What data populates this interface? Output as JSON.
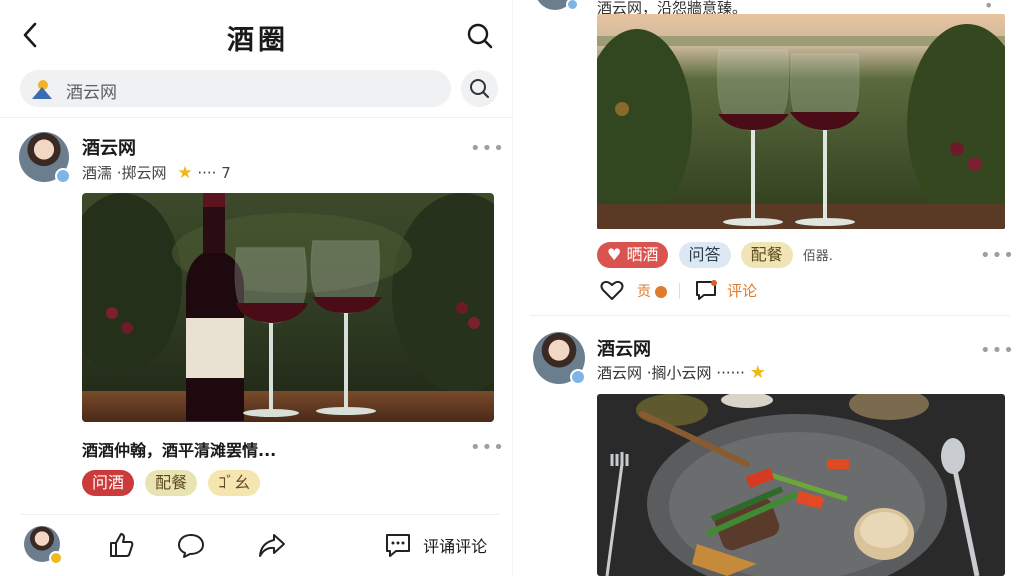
{
  "header": {
    "title": "酒圈"
  },
  "search": {
    "placeholder": "酒云网"
  },
  "left_post": {
    "author": "酒云网",
    "subline": "酒濡 ·掷云网",
    "subline_count": "···· 7",
    "caption": "酒酒仲翰，酒平清滩罢情...",
    "tags": [
      {
        "label": "问酒",
        "color": "#cc3b3b",
        "text_color": "#ffffff"
      },
      {
        "label": "配餐",
        "color": "#e9e3b4",
        "text_color": "#5b4a1a"
      },
      {
        "label": "ｺﾞ幺",
        "color": "#f5e6b0",
        "text_color": "#6a4a2a"
      }
    ]
  },
  "bottom_bar": {
    "comment_label": "评诵评论"
  },
  "right_post_top": {
    "author_line": "酒云网，沿怨牆意臻。",
    "tags": [
      {
        "label": "晒酒",
        "color": "#d9534f",
        "text_color": "#ffffff",
        "icon": "heart-icon"
      },
      {
        "label": "问答",
        "color": "#dde8f5",
        "text_color": "#2d3a4a"
      },
      {
        "label": "配餐",
        "color": "#f1e4b6",
        "text_color": "#5b4a1a"
      }
    ],
    "extra_tag": "佰器.",
    "like_label": "贡",
    "comment_label": "评论"
  },
  "right_post_bottom": {
    "author": "酒云网",
    "subline": "酒云网 ·搁小云网 ······"
  },
  "colors": {
    "accent_red": "#c93a3a",
    "muted": "#9aa0a6",
    "orange": "#e07b2c"
  }
}
